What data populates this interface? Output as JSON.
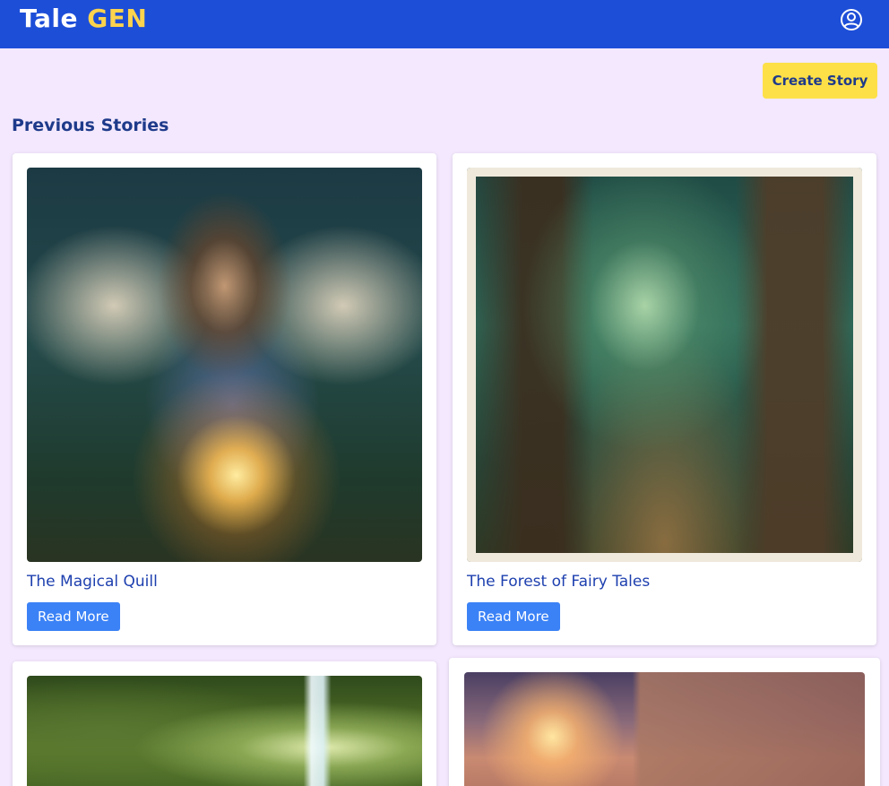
{
  "brand": {
    "word1": "Tale",
    "word2": "GEN"
  },
  "header": {
    "profile_icon": "user-circle-icon"
  },
  "actions": {
    "create_story_label": "Create Story"
  },
  "section": {
    "title": "Previous Stories"
  },
  "stories": [
    {
      "title": "The Magical Quill",
      "read_more_label": "Read More"
    },
    {
      "title": "The Forest of Fairy Tales",
      "read_more_label": "Read More"
    },
    {
      "title": "",
      "read_more_label": ""
    },
    {
      "title": "",
      "read_more_label": ""
    }
  ],
  "colors": {
    "navbar": "#1d4ed8",
    "brand_accent": "#fcd34d",
    "page_background": "#f3e8fd",
    "primary_button": "#fde047",
    "read_more_button": "#3b82f6",
    "heading_text": "#1e3a8a"
  }
}
